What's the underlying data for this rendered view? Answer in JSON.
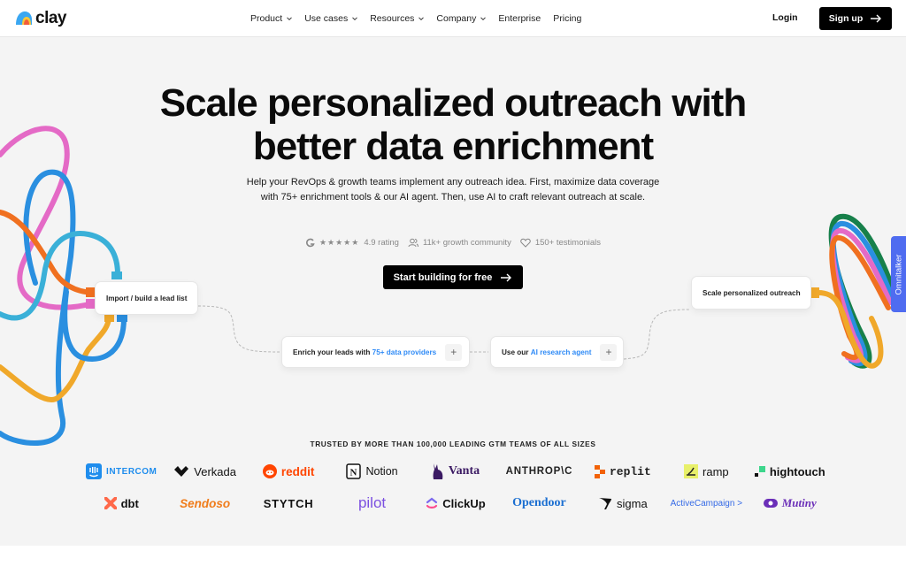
{
  "nav": {
    "logo_text": "clay",
    "links": [
      {
        "label": "Product",
        "has_dropdown": true
      },
      {
        "label": "Use cases",
        "has_dropdown": true
      },
      {
        "label": "Resources",
        "has_dropdown": true
      },
      {
        "label": "Company",
        "has_dropdown": true
      },
      {
        "label": "Enterprise",
        "has_dropdown": false
      },
      {
        "label": "Pricing",
        "has_dropdown": false
      }
    ],
    "login_label": "Login",
    "signup_label": "Sign up",
    "signup_icon": "arrow-right-icon"
  },
  "hero": {
    "title_line1": "Scale personalized outreach with",
    "title_line2": "better data enrichment",
    "subtitle": "Help your RevOps & growth teams implement any outreach idea. First, maximize data coverage with 75+ enrichment tools & our AI agent. Then, use AI to craft relevant outreach at scale.",
    "stats": {
      "rating_icon": "g2-icon",
      "stars": 5,
      "stars_glyph": "★★★★★",
      "rating_label": "4.9 rating",
      "community_icon": "users-icon",
      "community_label": "11k+ growth community",
      "testimonials_icon": "heart-icon",
      "testimonials_label": "150+ testimonials"
    },
    "cta_label": "Start building for free",
    "cta_icon": "arrow-right-icon"
  },
  "flow": {
    "import": {
      "label": "Import / build a lead list"
    },
    "enrich": {
      "prefix": "Enrich your leads with ",
      "highlight": "75+ data providers",
      "action": "+"
    },
    "agent": {
      "prefix": "Use our ",
      "highlight": "AI research agent",
      "action": "+"
    },
    "scale": {
      "label": "Scale personalized outreach"
    }
  },
  "omnitalker": {
    "label": "Omnitalker"
  },
  "trusted": {
    "heading": "TRUSTED BY MORE THAN 100,000 LEADING GTM TEAMS OF ALL SIZES",
    "logos": [
      {
        "name": "INTERCOM",
        "color": "#1f8ded"
      },
      {
        "name": "Verkada",
        "color": "#111111"
      },
      {
        "name": "reddit",
        "color": "#ff4500"
      },
      {
        "name": "Notion",
        "color": "#111111"
      },
      {
        "name": "Vanta",
        "color": "#3b1a63"
      },
      {
        "name": "ANTHROP\\C",
        "color": "#222222"
      },
      {
        "name": "replit",
        "color": "#222222"
      },
      {
        "name": "ramp",
        "color": "#222222"
      },
      {
        "name": "hightouch",
        "color": "#111111"
      },
      {
        "name": "dbt",
        "color": "#222222"
      },
      {
        "name": "Sendoso",
        "color": "#f07c1a"
      },
      {
        "name": "STYTCH",
        "color": "#111111"
      },
      {
        "name": "pilot",
        "color": "#7b4fe0"
      },
      {
        "name": "ClickUp",
        "color": "#111111"
      },
      {
        "name": "Opendoor",
        "color": "#1c6fd1"
      },
      {
        "name": "sigma",
        "color": "#111111"
      },
      {
        "name": "ActiveCampaign >",
        "color": "#356ae6"
      },
      {
        "name": "Mutiny",
        "color": "#6b2fb8"
      }
    ]
  },
  "colors": {
    "accent_blue": "#2e8af6",
    "cta_black": "#000000",
    "omnitalker_blue": "#4f6cf0"
  }
}
